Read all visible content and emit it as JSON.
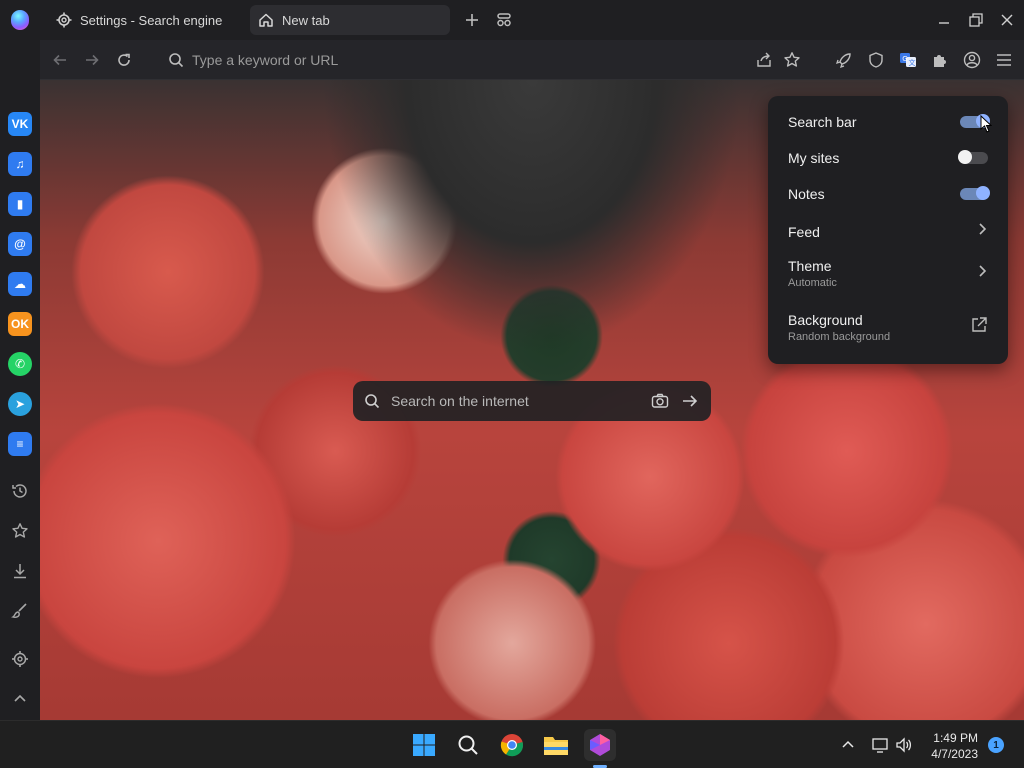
{
  "tabs": [
    {
      "label": "Settings - Search engine",
      "icon": "gear-icon"
    },
    {
      "label": "New tab",
      "icon": "home-icon"
    }
  ],
  "address_bar": {
    "placeholder": "Type a keyword or URL"
  },
  "ntp_search": {
    "placeholder": "Search on the internet"
  },
  "settings_panel": {
    "search_bar": "Search bar",
    "my_sites": "My sites",
    "notes": "Notes",
    "feed": "Feed",
    "theme": "Theme",
    "theme_value": "Automatic",
    "background": "Background",
    "background_value": "Random background"
  },
  "sidebar_apps": [
    {
      "name": "vk",
      "label": "VK",
      "color": "#2787f5"
    },
    {
      "name": "music",
      "label": "♫",
      "color": "#2f7bf0"
    },
    {
      "name": "stats",
      "label": "▮",
      "color": "#2f7bf0"
    },
    {
      "name": "mail",
      "label": "@",
      "color": "#2f7bf0"
    },
    {
      "name": "cloud",
      "label": "☁",
      "color": "#2f7bf0"
    },
    {
      "name": "ok",
      "label": "OK",
      "color": "#f7931e"
    },
    {
      "name": "whatsapp",
      "label": "✆",
      "color": "#25d366"
    },
    {
      "name": "telegram",
      "label": "➤",
      "color": "#2aa1de"
    },
    {
      "name": "tasks",
      "label": "≡",
      "color": "#2f7bf0"
    }
  ],
  "taskbar": {
    "time": "1:49 PM",
    "date": "4/7/2023",
    "notification_count": "1"
  },
  "colors": {
    "accent": "#8fb2ff",
    "panel_bg": "#1f1f22"
  }
}
